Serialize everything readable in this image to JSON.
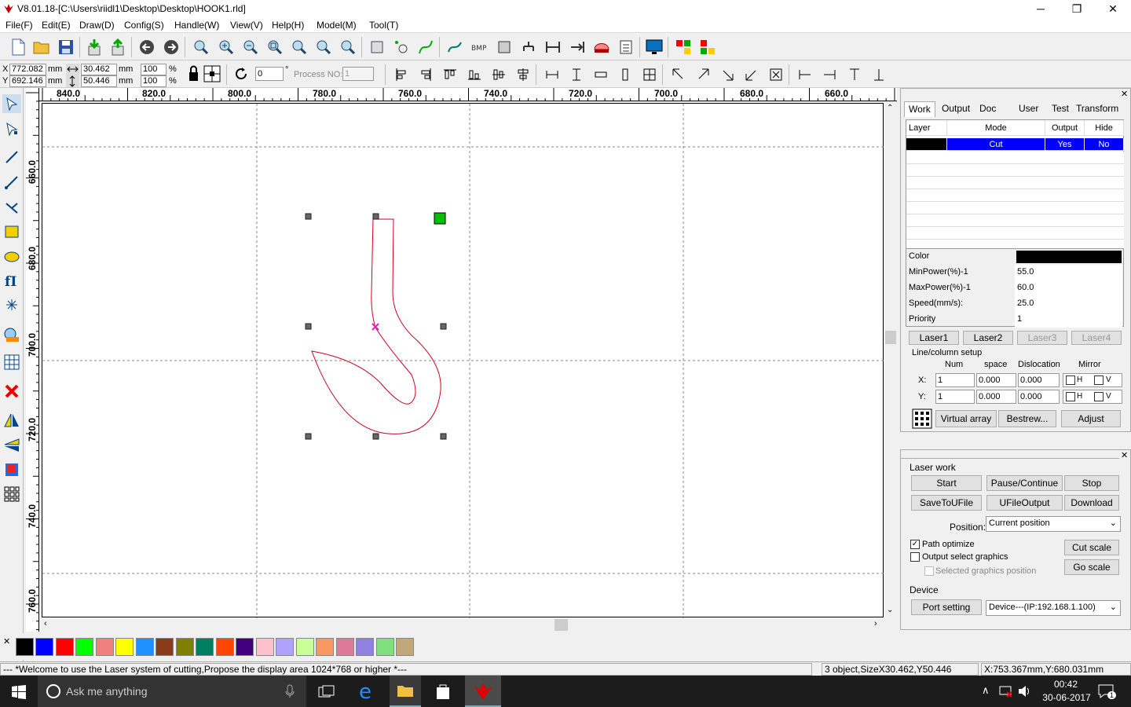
{
  "window": {
    "title": "V8.01.18-[C:\\Users\\riidl1\\Desktop\\Desktop\\HOOK1.rld]",
    "minimize": "─",
    "maximize": "❐",
    "close": "✕"
  },
  "menu": [
    "File(F)",
    "Edit(E)",
    "Draw(D)",
    "Config(S)",
    "Handle(W)",
    "View(V)",
    "Help(H)",
    "Model(M)",
    "Tool(T)"
  ],
  "position_box": {
    "x_label": "X",
    "x_value": "772.082",
    "x_unit": "mm",
    "y_label": "Y",
    "y_value": "692.146",
    "y_unit": "mm",
    "w_value": "30.462",
    "w_unit": "mm",
    "h_value": "50.446",
    "h_unit": "mm",
    "sx_value": "100",
    "sx_unit": "%",
    "sy_value": "100",
    "sy_unit": "%",
    "rotate_value": "0",
    "rotate_unit": "°",
    "process_label": "Process NO:",
    "process_value": "1"
  },
  "hruler_labels": [
    "840.0",
    "820.0",
    "800.0",
    "780.0",
    "760.0",
    "740.0",
    "720.0",
    "700.0",
    "680.0",
    "660.0"
  ],
  "vruler_labels": [
    "660.0",
    "680.0",
    "700.0",
    "720.0",
    "740.0",
    "760.0"
  ],
  "panel_work": {
    "tabs": [
      "Work",
      "Output",
      "Doc",
      "User",
      "Test",
      "Transform"
    ],
    "layer_headers": [
      "Layer",
      "Mode",
      "Output",
      "Hide"
    ],
    "layer_row": {
      "mode": "Cut",
      "output": "Yes",
      "hide": "No",
      "color": "#000000"
    },
    "props": [
      {
        "label": "Color",
        "value": ""
      },
      {
        "label": "MinPower(%)-1",
        "value": "55.0"
      },
      {
        "label": "MaxPower(%)-1",
        "value": "60.0"
      },
      {
        "label": "Speed(mm/s):",
        "value": "25.0"
      },
      {
        "label": "Priority",
        "value": "1"
      }
    ],
    "lasers": [
      "Laser1",
      "Laser2",
      "Laser3",
      "Laser4"
    ],
    "line_column_setup": "Line/column setup",
    "lc_headers": [
      "Num",
      "space",
      "Dislocation",
      "Mirror"
    ],
    "x_label": "X:",
    "y_label": "Y:",
    "x_row": {
      "num": "1",
      "space": "0.000",
      "disloc": "0.000"
    },
    "y_row": {
      "num": "1",
      "space": "0.000",
      "disloc": "0.000"
    },
    "mirror_h": "H",
    "mirror_v": "V",
    "btn_virtual": "Virtual array",
    "btn_bestrew": "Bestrew...",
    "btn_adjust": "Adjust"
  },
  "panel_laser": {
    "title": "Laser work",
    "btn_start": "Start",
    "btn_pause": "Pause/Continue",
    "btn_stop": "Stop",
    "btn_save": "SaveToUFile",
    "btn_ufile": "UFileOutput",
    "btn_download": "Download",
    "position_label": "Position:",
    "position_value": "Current position",
    "path_optimize": "Path optimize",
    "output_select": "Output select graphics",
    "selected_pos": "Selected graphics position",
    "btn_cut_scale": "Cut scale",
    "btn_go_scale": "Go scale",
    "device_label": "Device",
    "btn_port": "Port setting",
    "device_value": "Device---(IP:192.168.1.100)"
  },
  "palette": [
    "#000000",
    "#0000ff",
    "#ff0000",
    "#00ff00",
    "#f08080",
    "#ffff00",
    "#1e90ff",
    "#8b3a1a",
    "#808000",
    "#008060",
    "#ff4500",
    "#400080",
    "#ffc0cb",
    "#b0a0ff",
    "#c8ff96",
    "#f89860",
    "#e07898",
    "#9080e0",
    "#80e080",
    "#c0a878"
  ],
  "status": {
    "message": "--- *Welcome to use the Laser system of cutting,Propose the display area 1024*768 or higher *---",
    "selection": "3 object,SizeX30.462,Y50.446",
    "coords": "X:753.367mm,Y:680.031mm"
  },
  "taskbar": {
    "search_placeholder": "Ask me anything",
    "time": "00:42",
    "date": "30-06-2017",
    "notif_count": "1"
  },
  "colors": {
    "accent": "#0000ff",
    "shape": "#d00020",
    "handle_green": "#00c000"
  }
}
